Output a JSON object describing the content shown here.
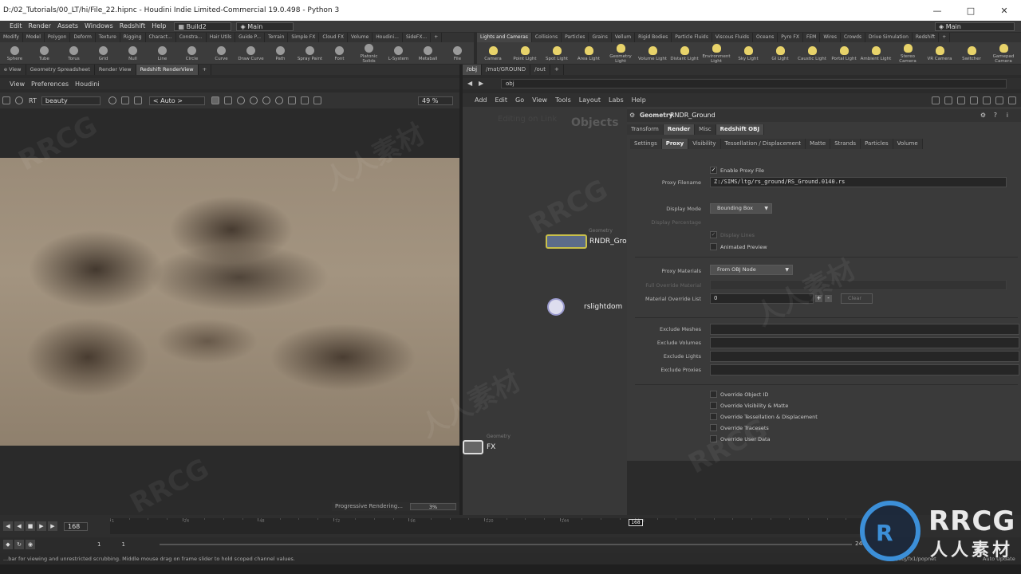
{
  "titlebar": {
    "text": "D:/02_Tutorials/00_LT/hi/File_22.hipnc - Houdini Indie Limited-Commercial 19.0.498 - Python 3"
  },
  "menubar": {
    "items": [
      "Edit",
      "Render",
      "Assets",
      "Windows",
      "Redshift",
      "Help"
    ],
    "desktop": "Build2",
    "shelfset": "Main",
    "shelfset_right": "Main"
  },
  "shelf_left": {
    "tabs": [
      "Modify",
      "Model",
      "Polygon",
      "Deform",
      "Texture",
      "Rigging",
      "Charact...",
      "Constra...",
      "Hair Utils",
      "Guide P...",
      "Terrain",
      "Simple FX",
      "Cloud FX",
      "Volume",
      "Houdini...",
      "SideFX..."
    ],
    "tools": [
      "Sphere",
      "Tube",
      "Torus",
      "Grid",
      "Null",
      "Line",
      "Circle",
      "Curve",
      "Draw Curve",
      "Path",
      "Spray Paint",
      "Font",
      "Platonic Solids",
      "L-System",
      "Metaball",
      "File"
    ]
  },
  "shelf_right": {
    "tabs": [
      "Lights and Cameras",
      "Collisions",
      "Particles",
      "Grains",
      "Vellum",
      "Rigid Bodies",
      "Particle Fluids",
      "Viscous Fluids",
      "Oceans",
      "Pyro FX",
      "FEM",
      "Wires",
      "Crowds",
      "Drive Simulation",
      "Redshift"
    ],
    "tools": [
      "Camera",
      "Point Light",
      "Spot Light",
      "Area Light",
      "Geometry Light",
      "Volume Light",
      "Distant Light",
      "Environment Light",
      "Sky Light",
      "GI Light",
      "Caustic Light",
      "Portal Light",
      "Ambient Light",
      "Stereo Camera",
      "VR Camera",
      "Switcher",
      "Gamepad Camera"
    ]
  },
  "left_pane": {
    "tabs": [
      "e View",
      "Geometry Spreadsheet",
      "Render View",
      "Redshift RenderView"
    ],
    "menu": [
      "View",
      "Preferences",
      "Houdini"
    ],
    "aov": "beauty",
    "auto": "< Auto >",
    "zoom": "49 %",
    "rt_label": "RT",
    "progress_label": "Progressive Rendering...",
    "progress_value": "3%"
  },
  "right_pane": {
    "path_tabs": [
      "/obj",
      "/mat/GROUND",
      "/out"
    ],
    "location": "obj",
    "menu": [
      "Add",
      "Edit",
      "Go",
      "View",
      "Tools",
      "Layout",
      "Labs",
      "Help"
    ],
    "net_title": "Objects",
    "net_ghost": "Editing on Link",
    "nodes": [
      {
        "type": "Geometry",
        "name": "RNDR_Gro"
      },
      {
        "type": "",
        "name": "rslightdom"
      },
      {
        "type": "Geometry",
        "name": "FX"
      }
    ]
  },
  "params": {
    "node_type": "Geometry",
    "node_name": "RNDR_Ground",
    "tabs1": [
      "Transform",
      "Render",
      "Misc",
      "Redshift OBJ"
    ],
    "tabs2": [
      "Settings",
      "Proxy",
      "Visibility",
      "Tessellation / Displacement",
      "Matte",
      "Strands",
      "Particles",
      "Volume"
    ],
    "enable_proxy": "Enable Proxy File",
    "proxy_filename_label": "Proxy Filename",
    "proxy_filename": "Z:/SIMS/ltg/rs_ground/RS_Ground.0140.rs",
    "display_mode_label": "Display Mode",
    "display_mode": "Bounding Box",
    "display_percentage_label": "Display Percentage",
    "display_lines": "Display Lines",
    "animated_preview": "Animated Preview",
    "proxy_materials_label": "Proxy Materials",
    "proxy_materials": "From OBJ Node",
    "full_override_label": "Full Override Material",
    "override_list_label": "Material Override List",
    "override_list_value": "0",
    "clear_label": "Clear",
    "exclude_labels": [
      "Exclude Meshes",
      "Exclude Volumes",
      "Exclude Lights",
      "Exclude Proxies"
    ],
    "overrides": [
      "Override Object ID",
      "Override Visibility & Matte",
      "Override Tessellation & Displacement",
      "Override Tracesets",
      "Override User Data"
    ]
  },
  "timeline": {
    "frame": "168",
    "ticks": [
      "1",
      "24",
      "48",
      "72",
      "96",
      "120",
      "144",
      "168"
    ],
    "current_marker": "168",
    "range_start": "1",
    "range_start2": "1",
    "range_end": "240"
  },
  "status": {
    "message": "...bar for viewing and unrestricted scrubbing. Middle mouse drag on frame slider to hold scoped channel values.",
    "net_path": "/obj/fx1/popnet",
    "auto_update": "Auto Update"
  },
  "watermark": {
    "text1": "RRCG",
    "text2": "人人素材"
  }
}
